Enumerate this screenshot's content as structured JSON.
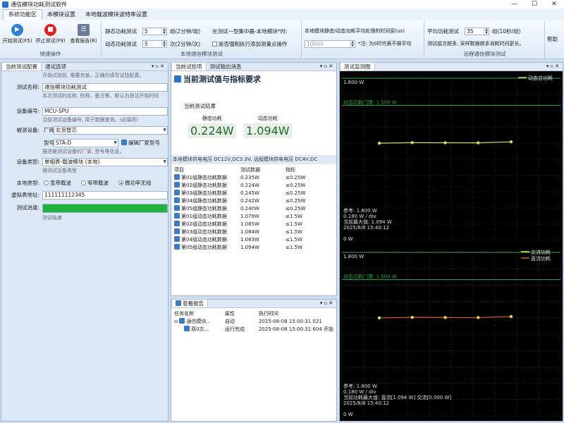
{
  "window": {
    "title": "通信模块功耗测试软件"
  },
  "menu": {
    "tabs": [
      "系统功能区",
      "本模块设置",
      "本地载波模块波特率设置"
    ],
    "active": 0
  },
  "ribbon": {
    "quick_ops": {
      "start": "开始测试(F5)",
      "stop": "停止测试(F9)",
      "report": "查看报告(R)",
      "group_label": "快速操作"
    },
    "local_test": {
      "static_label": "静态功耗测试",
      "static_value": "5",
      "static_unit": "组(2分钟/组)",
      "dynamic_label": "动态功耗测试",
      "dynamic_value": "5",
      "dynamic_unit": "次(2分钟/次)",
      "concentrator_label": "在测试一型集中器-本地模块*时:",
      "force_label": "是否强制执行添加测量点操作",
      "avg_label": "本地模块静态/动态功耗平均处理的时间窗(us)",
      "avg_value": "10000",
      "avg_note": "*注: 为0时代表不做平均",
      "group_label": "本地通信模块测试"
    },
    "remote_test": {
      "avg_test_label": "平均功耗测试",
      "avg_test_value": "35",
      "avg_test_unit": "组(10秒/组)",
      "note": "测试组次越多, 采样数据越多消耗时间更长。",
      "group_label": "远程通信模块测试"
    },
    "help": "帮助"
  },
  "left_panel": {
    "tabs": [
      "当前测试配置",
      "通试选项"
    ],
    "intro": "开始试验前, 需要完善、正确的填写试验配置。",
    "name_label": "测试名称:",
    "name_value": "通信模块功耗测试",
    "name_hint": "本次测试的名称, 别称、备注等。默认为测试开始时间",
    "device_id_label": "设备编号:",
    "device_id_value": "MCU-SPU",
    "device_id_hint": "当前测试设备编号, 用于数据查询。(必填项)",
    "device_label": "被测设备:",
    "vendor_prefix": "厂商",
    "vendor_value": "北京智芯",
    "model_prefix": "型号",
    "model_value": "STA-D",
    "edit_vendor": "编辑厂家型号",
    "device_hint": "描述被测试设备的厂家, 型号等信息。",
    "type_label": "设备类型:",
    "type_value": "单相表-载波模块 (本地)",
    "type_hint": "被测试设备类型",
    "local_type_label": "本地类型:",
    "local_types": [
      "宽带载波",
      "窄带载波",
      "微功率无线"
    ],
    "local_type_selected": 2,
    "address_label": "虚拟表地址:",
    "address_value": "111111112345",
    "progress_label": "测试进度:",
    "progress_fraction": 1.0,
    "progress_status": "测试结束"
  },
  "middle_panel": {
    "tabs": [
      "当前试验项",
      "测试输出消息"
    ],
    "title": "当前测试值与指标要求",
    "result_label": "当前测试结果",
    "static_name": "静态功耗",
    "static_value": "0.224W",
    "dynamic_name": "动态功耗",
    "dynamic_value": "1.094W",
    "supply_info": "本地模块供电电压 DC12V,DC3.3V, 远程模块供电电压 DC4V,DC",
    "table_headers": [
      "项目",
      "测试数据",
      "指标"
    ],
    "rows": [
      {
        "item": "第01组静态功耗数据",
        "data": "0.235W",
        "spec": "≤0.25W"
      },
      {
        "item": "第02组静态功耗数据",
        "data": "0.224W",
        "spec": "≤0.25W"
      },
      {
        "item": "第03组静态功耗数据",
        "data": "0.245W",
        "spec": "≤0.25W"
      },
      {
        "item": "第04组静态功耗数据",
        "data": "0.242W",
        "spec": "≤0.25W"
      },
      {
        "item": "第05组静态功耗数据",
        "data": "0.240W",
        "spec": "≤0.25W"
      },
      {
        "item": "第01组动态功耗数据",
        "data": "1.079W",
        "spec": "≤1.5W"
      },
      {
        "item": "第02组动态功耗数据",
        "data": "1.085W",
        "spec": "≤1.5W"
      },
      {
        "item": "第03组动态功耗数据",
        "data": "1.084W",
        "spec": "≤1.5W"
      },
      {
        "item": "第04组动态功耗数据",
        "data": "1.083W",
        "spec": "≤1.5W"
      },
      {
        "item": "第05组动态功耗数据",
        "data": "1.094W",
        "spec": "≤1.5W"
      }
    ],
    "report_tab": "查看报告",
    "report_headers": [
      "任务名称",
      "属性",
      "执行时间"
    ],
    "report_rows": [
      {
        "name": "通信模块...",
        "attr": "自动",
        "time": "2025-08-08 15:00:31 021"
      },
      {
        "name": "原0次...",
        "attr": "运行完成",
        "time": "2025-08-08 15:00:31 604 开始"
      }
    ]
  },
  "right_panel": {
    "tab": "测试监测图",
    "chart1": {
      "top_label": "1.800 W",
      "legend": "动态总功耗",
      "threshold_label": "动态功耗门限: 1.500 W",
      "info_lines": [
        "参考: 1.800 W",
        "0.180 W / div",
        "当前最大值: 1.094 W",
        "2025/8/8 15:40:12"
      ],
      "bottom_label": "0 W"
    },
    "chart2": {
      "top_label": "1.800 W",
      "legend": [
        "交流功耗",
        "直流功耗"
      ],
      "threshold_label": "动态功耗门限: 1.500 W",
      "info_lines": [
        "参考: 1.800 W",
        "0.180 W / div",
        "当前功耗最大值: 直流[1.094 W] 交流[0.000 W]",
        "2025/8/8 15:40:12"
      ],
      "bottom_label": "0 W"
    }
  },
  "chart_data": [
    {
      "type": "line",
      "ylabel": "",
      "ylim": [
        0,
        1.8
      ],
      "threshold": 1.5,
      "x": [
        1,
        2,
        3,
        4,
        5
      ],
      "series": [
        {
          "name": "动态总功耗",
          "values": [
            1.079,
            1.085,
            1.084,
            1.083,
            1.094
          ]
        }
      ],
      "colors": {
        "series": "#c8e05a",
        "threshold": "#2ea84a",
        "grid": "#4a4a4a"
      }
    },
    {
      "type": "line",
      "ylabel": "",
      "ylim": [
        0,
        1.8
      ],
      "threshold": 1.5,
      "x": [
        1,
        2,
        3,
        4,
        5
      ],
      "series": [
        {
          "name": "交流功耗",
          "values": [
            0,
            0,
            0,
            0,
            0
          ]
        },
        {
          "name": "直流功耗",
          "values": [
            1.079,
            1.085,
            1.084,
            1.083,
            1.094
          ]
        }
      ],
      "colors": {
        "ac": "#e8e84a",
        "dc": "#d9532e",
        "grid": "#4a4a4a",
        "threshold": "#2ea84a"
      }
    }
  ]
}
